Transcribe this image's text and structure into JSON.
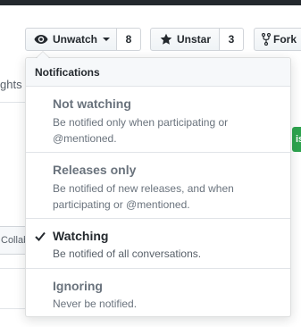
{
  "actions": {
    "watch": {
      "label": "Unwatch",
      "count": "8"
    },
    "star": {
      "label": "Unstar",
      "count": "3"
    },
    "fork": {
      "label": "Fork"
    }
  },
  "background": {
    "left_fragment": "ghts",
    "collab_fragment": "Collab",
    "green_fragment": "is"
  },
  "notifications": {
    "header": "Notifications",
    "items": [
      {
        "title": "Not watching",
        "description": "Be notified only when participating or @mentioned.",
        "selected": false
      },
      {
        "title": "Releases only",
        "description": "Be notified of new releases, and when participating or @mentioned.",
        "selected": false
      },
      {
        "title": "Watching",
        "description": "Be notified of all conversations.",
        "selected": true
      },
      {
        "title": "Ignoring",
        "description": "Never be notified.",
        "selected": false
      }
    ]
  },
  "icons": {
    "watch": "eye-icon",
    "star": "star-icon",
    "fork": "repo-forked-icon",
    "selected": "check-icon",
    "dropdown": "caret-down-icon"
  },
  "colors": {
    "topbar": "#24292e",
    "green_button": "#2ea44f",
    "muted_text": "#586069",
    "border": "#e1e4e8"
  }
}
